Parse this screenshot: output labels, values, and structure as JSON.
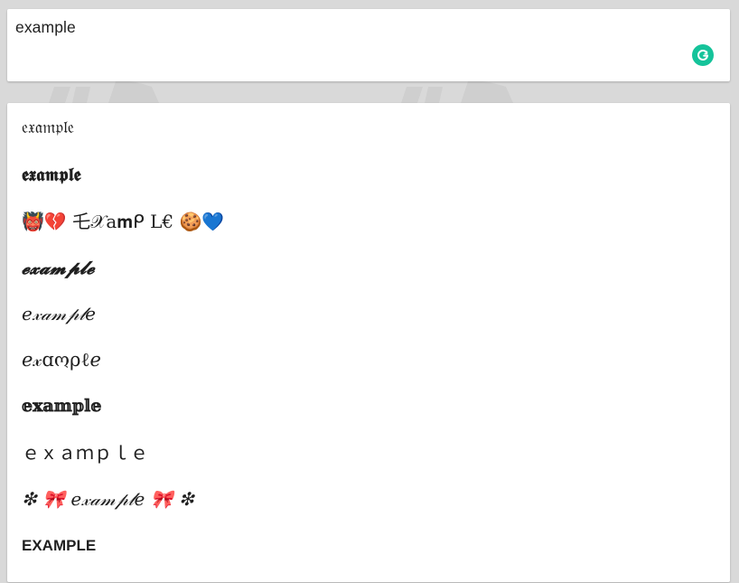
{
  "input": {
    "value": "example"
  },
  "icons": {
    "grammarly": "grammarly-g-icon",
    "grammarly_color": "#15c39a"
  },
  "results": [
    "𝔢𝔵𝔞𝔪𝔭𝔩𝔢",
    "𝖊𝖝𝖆𝖒𝖕𝖑𝖊",
    "👹💔 乇𝒳a𝐦ᑭ L€ 🍪💙",
    "𝓮𝔁𝓪𝓶𝓹𝓵𝓮",
    "𝑒𝓍𝒶𝓂𝓅𝓁𝑒",
    "ℯ𝓍ɑოρℓℯ",
    "𝕖𝕩𝕒𝕞𝕡𝕝𝕖",
    "ｅｘａｍｐｌｅ",
    "❇ 🎀 𝑒𝓍𝒶𝓂𝓅𝓁𝑒 🎀 ❇",
    "EXAMPLE"
  ]
}
